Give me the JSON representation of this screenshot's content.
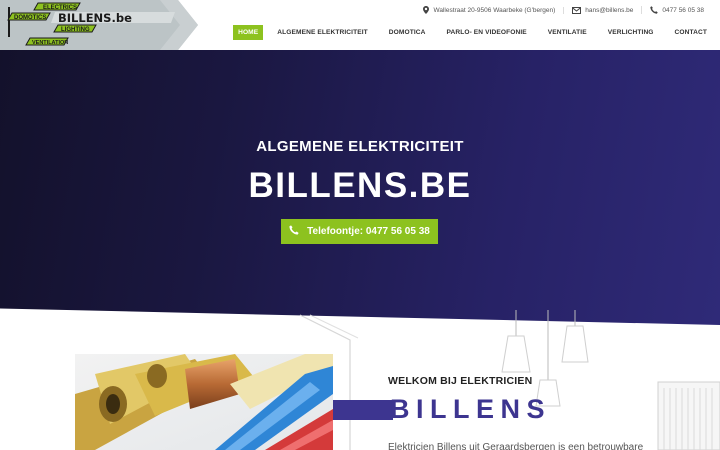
{
  "header": {
    "logo": {
      "words": [
        "ELECTRICS",
        "DOMOTICS",
        "BILLENS.be",
        "LIGHTING",
        "VENTILATION"
      ]
    },
    "topbar": {
      "address": "Wallestraat 20-9506 Waarbeke (G'bergen)",
      "email": "hans@billens.be",
      "phone": "0477 56 05 38"
    },
    "nav": {
      "items": [
        {
          "label": "HOME",
          "active": true
        },
        {
          "label": "ALGEMENE ELEKTRICITEIT",
          "active": false
        },
        {
          "label": "DOMOTICA",
          "active": false
        },
        {
          "label": "PARLO- EN VIDEOFONIE",
          "active": false
        },
        {
          "label": "VENTILATIE",
          "active": false
        },
        {
          "label": "VERLICHTING",
          "active": false
        },
        {
          "label": "CONTACT",
          "active": false
        }
      ]
    }
  },
  "hero": {
    "subtitle": "ALGEMENE ELEKTRICITEIT",
    "title": "BILLENS.BE",
    "cta_label": "Telefoontje: 0477 56 05 38"
  },
  "welcome": {
    "heading": "WELKOM BIJ ELEKTRICIEN",
    "brand": "BILLENS",
    "intro": "Elektricien Billens uit Geraardsbergen is een betrouwbare"
  },
  "colors": {
    "accent_green": "#8dc21f",
    "hero_dark": "#13112b",
    "hero_purple": "#2f2a78",
    "brand_purple": "#3d3590"
  },
  "icons": {
    "address": "map-pin-icon",
    "email": "envelope-icon",
    "phone": "phone-icon",
    "cta": "phone-icon"
  }
}
